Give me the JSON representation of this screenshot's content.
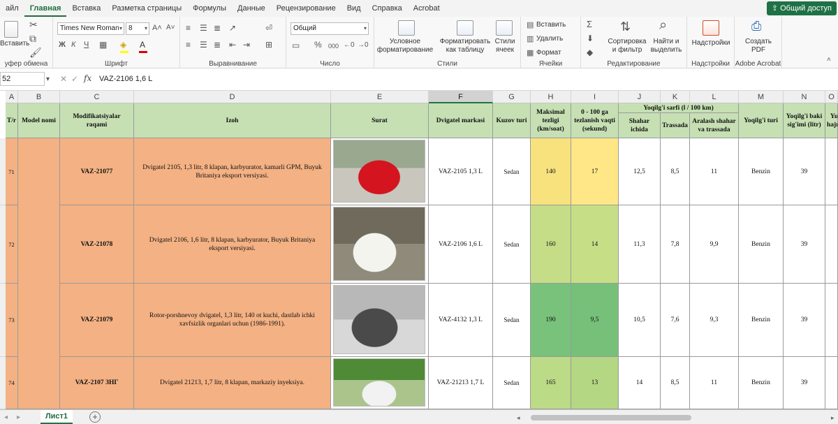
{
  "tabs": [
    "айл",
    "Главная",
    "Вставка",
    "Разметка страницы",
    "Формулы",
    "Данные",
    "Рецензирование",
    "Вид",
    "Справка",
    "Acrobat"
  ],
  "active_tab": "Главная",
  "share_label": "Общий доступ",
  "ribbon": {
    "clipboard": {
      "paste": "Вставить",
      "label": "уфер обмена"
    },
    "font": {
      "name": "Times New Roman",
      "size": "8",
      "label": "Шрифт",
      "bold": "Ж",
      "italic": "К",
      "underline": "Ч"
    },
    "alignment": {
      "label": "Выравнивание"
    },
    "number": {
      "format": "Общий",
      "label": "Число",
      "percent": "%",
      "thousands": "000"
    },
    "styles": {
      "conditional": "Условное форматирование",
      "table": "Форматировать как таблицу",
      "cell_styles": "Стили ячеек",
      "label": "Стили"
    },
    "cells": {
      "insert": "Вставить",
      "delete": "Удалить",
      "format": "Формат",
      "label": "Ячейки"
    },
    "editing": {
      "sort": "Сортировка и фильтр",
      "find": "Найти и выделить",
      "label": "Редактирование",
      "sum": "Σ"
    },
    "addins": {
      "btn": "Надстройки",
      "label": "Надстройки"
    },
    "acrobat": {
      "btn": "Создать PDF",
      "label": "Adobe Acrobat"
    }
  },
  "formula_bar": {
    "cell_ref": "52",
    "content": "VAZ-2106 1,6 L"
  },
  "columns": [
    "A",
    "B",
    "C",
    "D",
    "E",
    "F",
    "G",
    "H",
    "I",
    "J",
    "K",
    "L",
    "M",
    "N",
    "O"
  ],
  "selected_column": "F",
  "headers": {
    "tr": "T/r",
    "model": "Model nomi",
    "modif": "Modifikatsiyalar raqami",
    "izoh": "Izoh",
    "surat": "Surat",
    "engine": "Dvigatel markasi",
    "body": "Kuzov turi",
    "maxspeed": "Maksimal tezligi (km/soat)",
    "accel": "0 - 100 ga tezlanish vaqti (sekund)",
    "fuel_group": "Yoqilg'i sarfi (l / 100 km)",
    "city": "Shahar ichida",
    "highway": "Trassada",
    "mixed": "Aralash shahar va trassada",
    "fuel_type": "Yoqilg'i turi",
    "tank": "Yoqilg'i baki sig'imi (litr)",
    "extra": "Yu hajm"
  },
  "rows": [
    {
      "tr": "71",
      "modif": "VAZ-21077",
      "izoh": "Dvigatel 2105, 1,3 litr, 8 klapan, karbyurator, kamarli GPM, Buyuk Britaniya eksport versiyasi.",
      "engine": "VAZ-2105 1,3 L",
      "body": "Sedan",
      "maxspeed": "140",
      "accel": "17",
      "city": "12,5",
      "highway": "8,5",
      "mixed": "11",
      "fuel_type": "Benzin",
      "tank": "39",
      "speed_color": "#f8e27e",
      "accel_color": "#ffe787"
    },
    {
      "tr": "72",
      "modif": "VAZ-21078",
      "izoh": "Dvigatel 2106, 1,6 litr, 8 klapan, karbyurator, Buyuk Britaniya eksport versiyasi.",
      "engine": "VAZ-2106 1,6 L",
      "body": "Sedan",
      "maxspeed": "160",
      "accel": "14",
      "city": "11,3",
      "highway": "7,8",
      "mixed": "9,9",
      "fuel_type": "Benzin",
      "tank": "39",
      "speed_color": "#c4dd86",
      "accel_color": "#c6df87"
    },
    {
      "tr": "73",
      "modif": "VAZ-21079",
      "izoh": "Rotor-porshnevoy dvigatel, 1,3 litr, 140 ot kuchi, dastlab ichki xavfsizlik organlari uchun (1986-1991).",
      "engine": "VAZ-4132 1,3 L",
      "body": "Sedan",
      "maxspeed": "190",
      "accel": "9,5",
      "city": "10,5",
      "highway": "7,6",
      "mixed": "9,3",
      "fuel_type": "Benzin",
      "tank": "39",
      "speed_color": "#78c27b",
      "accel_color": "#76c07a"
    },
    {
      "tr": "74",
      "modif": "VAZ-2107 ЗНГ",
      "izoh": "Dvigatel 21213, 1,7 litr, 8 klapan, markaziy inyeksiya.",
      "engine": "VAZ-21213 1,7 L",
      "body": "Sedan",
      "maxspeed": "165",
      "accel": "13",
      "city": "14",
      "highway": "8,5",
      "mixed": "11",
      "fuel_type": "Benzin",
      "tank": "39",
      "speed_color": "#bcdb86",
      "accel_color": "#b4d783"
    }
  ],
  "sheet_name": "Лист1"
}
